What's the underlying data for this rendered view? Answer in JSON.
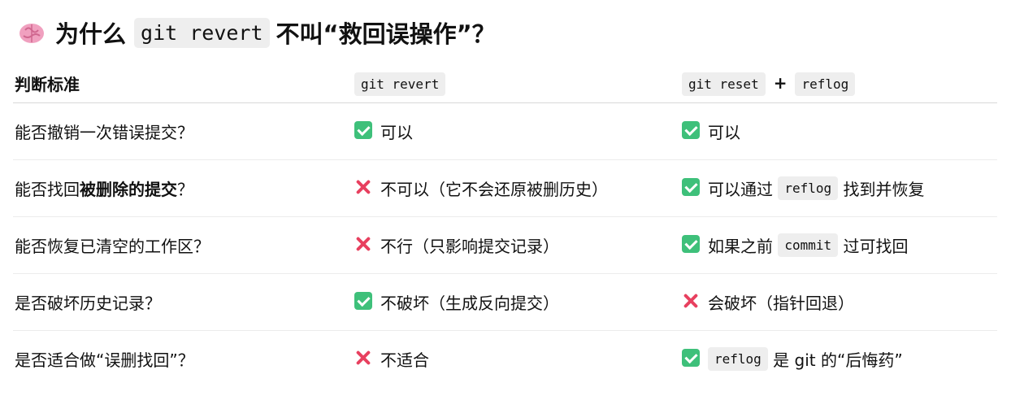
{
  "title": {
    "icon": "brain-icon",
    "prefix": "为什么",
    "code": "git revert",
    "suffix": "不叫“救回误操作”？"
  },
  "table": {
    "headers": {
      "criteria": "判断标准",
      "revert_code": "git revert",
      "reset_code": "git reset",
      "plus": "+",
      "reflog_code": "reflog"
    },
    "rows": [
      {
        "q": "能否撤销一次错误提交？",
        "revert": {
          "icon": "check-icon",
          "text": "可以"
        },
        "reset": {
          "icon": "check-icon",
          "text": "可以"
        }
      },
      {
        "q_prefix": "能否找回",
        "q_bold": "被删除的提交",
        "q_suffix": "？",
        "revert": {
          "icon": "cross-icon",
          "text": "不可以（它不会还原被删历史）"
        },
        "reset": {
          "icon": "check-icon",
          "text_before": "可以通过",
          "code": "reflog",
          "text_after": "找到并恢复"
        }
      },
      {
        "q": "能否恢复已清空的工作区？",
        "revert": {
          "icon": "cross-icon",
          "text": "不行（只影响提交记录）"
        },
        "reset": {
          "icon": "check-icon",
          "text_before": "如果之前",
          "code": "commit",
          "text_after": "过可找回"
        }
      },
      {
        "q": "是否破坏历史记录？",
        "revert": {
          "icon": "check-icon",
          "text": "不破坏（生成反向提交）"
        },
        "reset": {
          "icon": "cross-icon",
          "text": "会破坏（指针回退）"
        }
      },
      {
        "q": "是否适合做“误删找回”？",
        "revert": {
          "icon": "cross-icon",
          "text": "不适合"
        },
        "reset": {
          "icon": "check-icon",
          "code": "reflog",
          "text_after": "是 git 的“后悔药”"
        }
      }
    ]
  },
  "colors": {
    "check": "#3ec07a",
    "cross": "#e8405f",
    "code_bg": "#eeeeee"
  }
}
